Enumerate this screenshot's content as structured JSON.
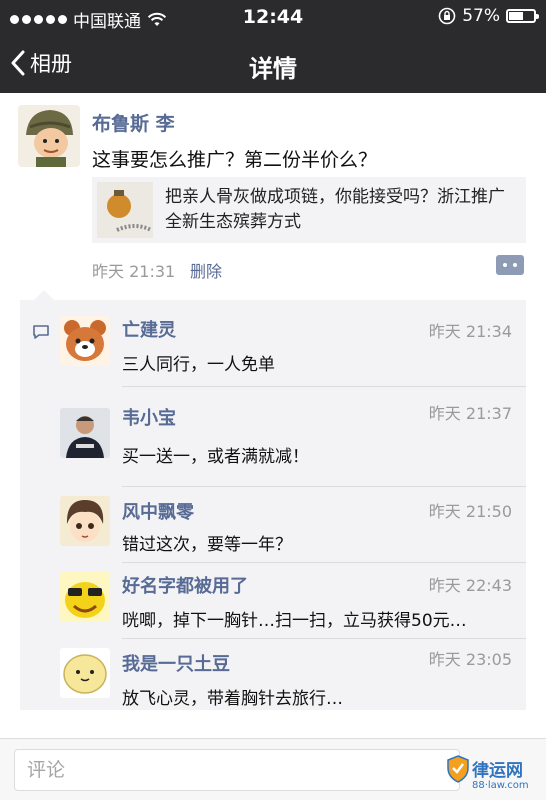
{
  "status_bar": {
    "carrier": "中国联通",
    "time": "12:44",
    "battery": "57%"
  },
  "nav": {
    "back_label": "相册",
    "title": "详情"
  },
  "post": {
    "author": "布鲁斯 李",
    "text": "这事要怎么推广？第二份半价么？",
    "link_title": "把亲人骨灰做成项链，你能接受吗？浙江推广全新生态殡葬方式",
    "time": "昨天 21:31",
    "delete_label": "删除"
  },
  "comments": [
    {
      "name": "亡建灵",
      "text": "三人同行，一人免单",
      "time": "昨天 21:34"
    },
    {
      "name": "韦小宝",
      "text": "买一送一，或者满就减！",
      "time": "昨天 21:37"
    },
    {
      "name": "风中飘零",
      "text": "错过这次，要等一年？",
      "time": "昨天 21:50"
    },
    {
      "name": "好名字都被用了",
      "text": "咣唧，掉下一胸针…扫一扫，立马获得50元…",
      "time": "昨天 22:43"
    },
    {
      "name": "我是一只土豆",
      "text": "放飞心灵，带着胸针去旅行…",
      "time": "昨天 23:05"
    }
  ],
  "comment_input": {
    "placeholder": "评论"
  },
  "watermark": {
    "text": "律运网",
    "url": "88·law.com"
  }
}
